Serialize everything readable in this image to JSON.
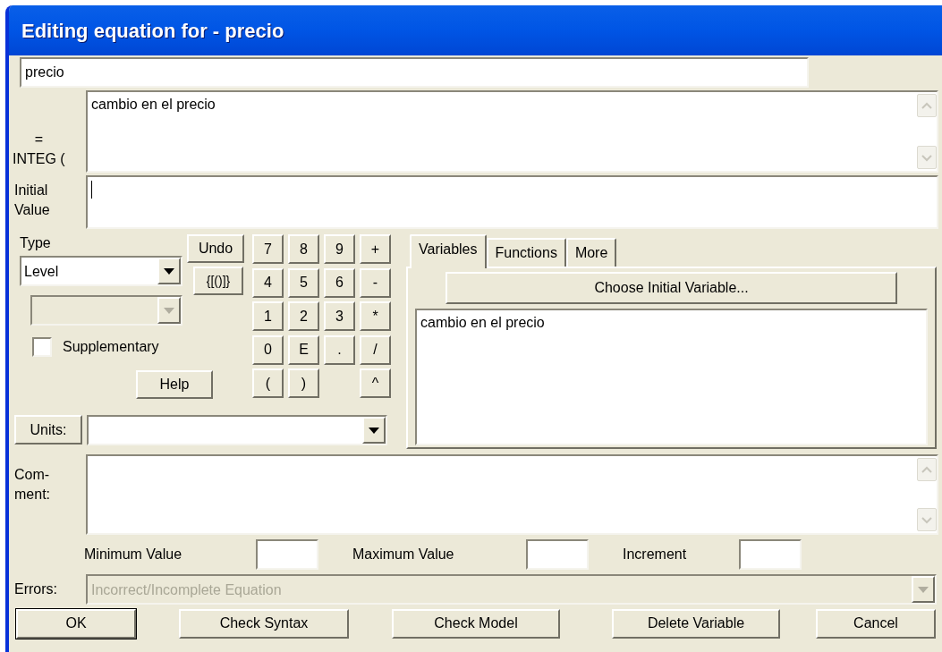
{
  "window": {
    "title": "Editing equation for - precio"
  },
  "name_field": {
    "value": "precio"
  },
  "equation": {
    "label": "=\nINTEG (",
    "value": "cambio en el precio"
  },
  "initial_value": {
    "label": "Initial\nValue",
    "focused": true
  },
  "type": {
    "label": "Type",
    "value": "Level",
    "subtype_disabled": true
  },
  "supplementary": {
    "label": "Supplementary",
    "checked": false
  },
  "edit_buttons": [
    "Undo",
    "{[()]}"
  ],
  "help_button": "Help",
  "keypad": [
    [
      "7",
      "8",
      "9",
      "+"
    ],
    [
      "4",
      "5",
      "6",
      "-"
    ],
    [
      "1",
      "2",
      "3",
      "*"
    ],
    [
      "0",
      "E",
      ".",
      "/"
    ],
    [
      "(",
      ")",
      "^"
    ]
  ],
  "tabs": [
    {
      "label": "Variables",
      "selected": true
    },
    {
      "label": "Functions",
      "selected": false
    },
    {
      "label": "More",
      "selected": false
    }
  ],
  "choose_button": "Choose Initial Variable...",
  "variables": [
    "cambio en el precio"
  ],
  "units": {
    "label": "Units:"
  },
  "comment": {
    "label": "Com-\nment:"
  },
  "ranges": [
    {
      "label": "Minimum Value"
    },
    {
      "label": "Maximum Value"
    },
    {
      "label": "Increment"
    }
  ],
  "errors": {
    "label": "Errors:",
    "value": "Incorrect/Incomplete Equation",
    "disabled": true
  },
  "buttons": [
    {
      "label": "OK",
      "default": true
    },
    {
      "label": "Check Syntax",
      "default": false
    },
    {
      "label": "Check Model",
      "default": false
    },
    {
      "label": "Delete Variable",
      "default": false
    },
    {
      "label": "Cancel",
      "default": false
    }
  ]
}
